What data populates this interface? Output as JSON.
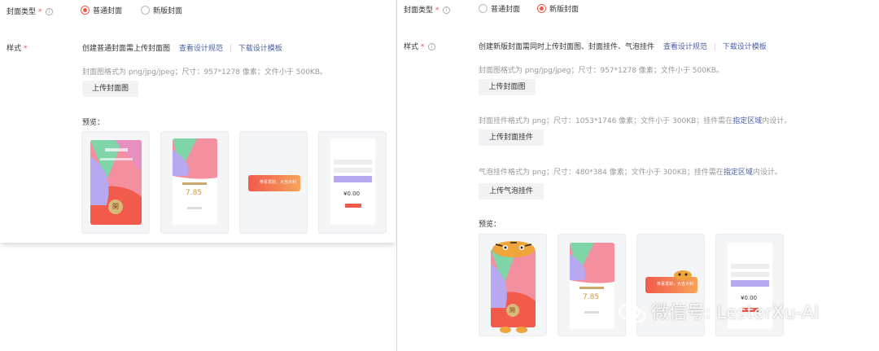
{
  "left": {
    "cover_type_label": "封面类型",
    "req_mark": "*",
    "info_glyph": "i",
    "radio_normal": "普通封面",
    "radio_new": "新版封面",
    "style_label": "样式",
    "style_desc": "创建普通封面需上传封面图",
    "link_spec": "查看设计规范",
    "link_template": "下载设计模板",
    "hint_format": "封面图格式为 png/jpg/jpeg；尺寸：957*1278 像素；文件小于 500KB。",
    "upload_cover": "上传封面图",
    "preview_label": "预览："
  },
  "right": {
    "cover_type_label": "封面类型",
    "req_mark": "*",
    "info_glyph": "i",
    "radio_normal": "普通封面",
    "radio_new": "新版封面",
    "style_label": "样式",
    "style_desc": "创建新版封面需同时上传封面图、封面挂件、气泡挂件",
    "link_spec": "查看设计规范",
    "link_template": "下载设计模板",
    "hint_cover": "封面图格式为 png/jpg/jpeg；尺寸：957*1278 像素；文件小于 500KB。",
    "upload_cover": "上传封面图",
    "hint_pendant_pre": "封面挂件格式为 png；尺寸：1053*1746 像素；文件小于 300KB；挂件需在",
    "hint_pendant_link": "指定区域",
    "hint_pendant_post": "内设计。",
    "upload_pendant": "上传封面挂件",
    "hint_bubble_pre": "气泡挂件格式为 png；尺寸：480*384 像素；文件小于 300KB；挂件需在",
    "hint_bubble_link": "指定区域",
    "hint_bubble_post": "内设计。",
    "upload_bubble": "上传气泡挂件",
    "preview_label": "预览："
  },
  "previews": {
    "open_glyph": "開",
    "amount_small": "7.85",
    "amount_large": "¥0.00",
    "banner_text": "恭喜发财，大吉大利"
  },
  "watermark": "微信号: LesterXu-AI",
  "colors": {
    "accent": "#f05a4a",
    "link": "#4a5fa8",
    "hint": "#999999",
    "button_bg": "#f2f3f5"
  }
}
